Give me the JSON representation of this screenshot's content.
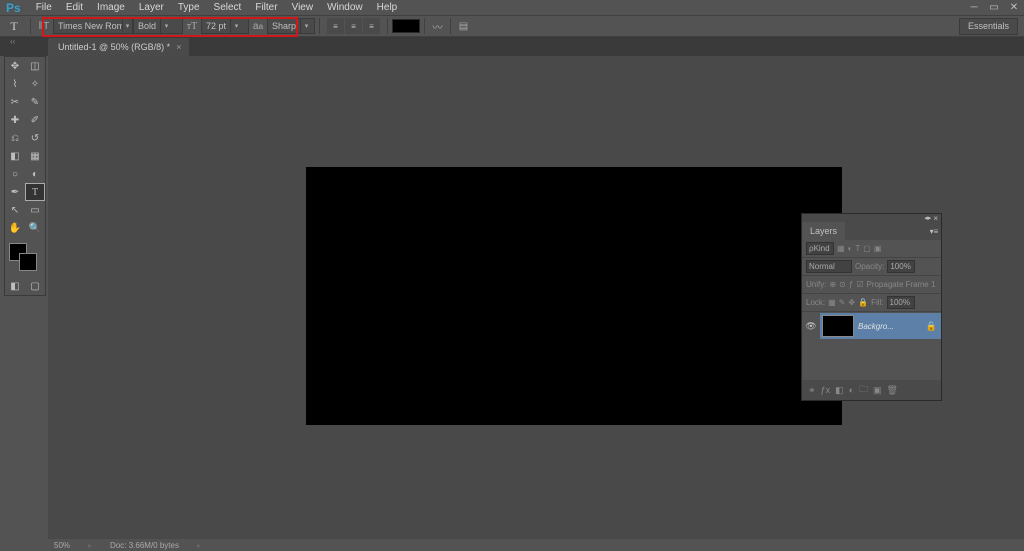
{
  "app": {
    "logo": "Ps"
  },
  "menu": [
    "File",
    "Edit",
    "Image",
    "Layer",
    "Type",
    "Select",
    "Filter",
    "View",
    "Window",
    "Help"
  ],
  "options": {
    "font_family": "Times New Rom...",
    "font_style": "Bold",
    "font_size": "72 pt",
    "anti_alias": "Sharp",
    "workspace": "Essentials"
  },
  "document": {
    "tab_title": "Untitled-1 @ 50% (RGB/8) *"
  },
  "status": {
    "zoom": "50%",
    "doc_info": "Doc: 3.66M/0 bytes"
  },
  "layers_panel": {
    "title": "Layers",
    "kind_label": "Kind",
    "blend_mode": "Normal",
    "opacity_label": "Opacity:",
    "opacity_value": "100%",
    "unify_label": "Unify:",
    "propagate_label": "Propagate Frame 1",
    "lock_label": "Lock:",
    "fill_label": "Fill:",
    "fill_value": "100%",
    "layer_name": "Backgro..."
  }
}
